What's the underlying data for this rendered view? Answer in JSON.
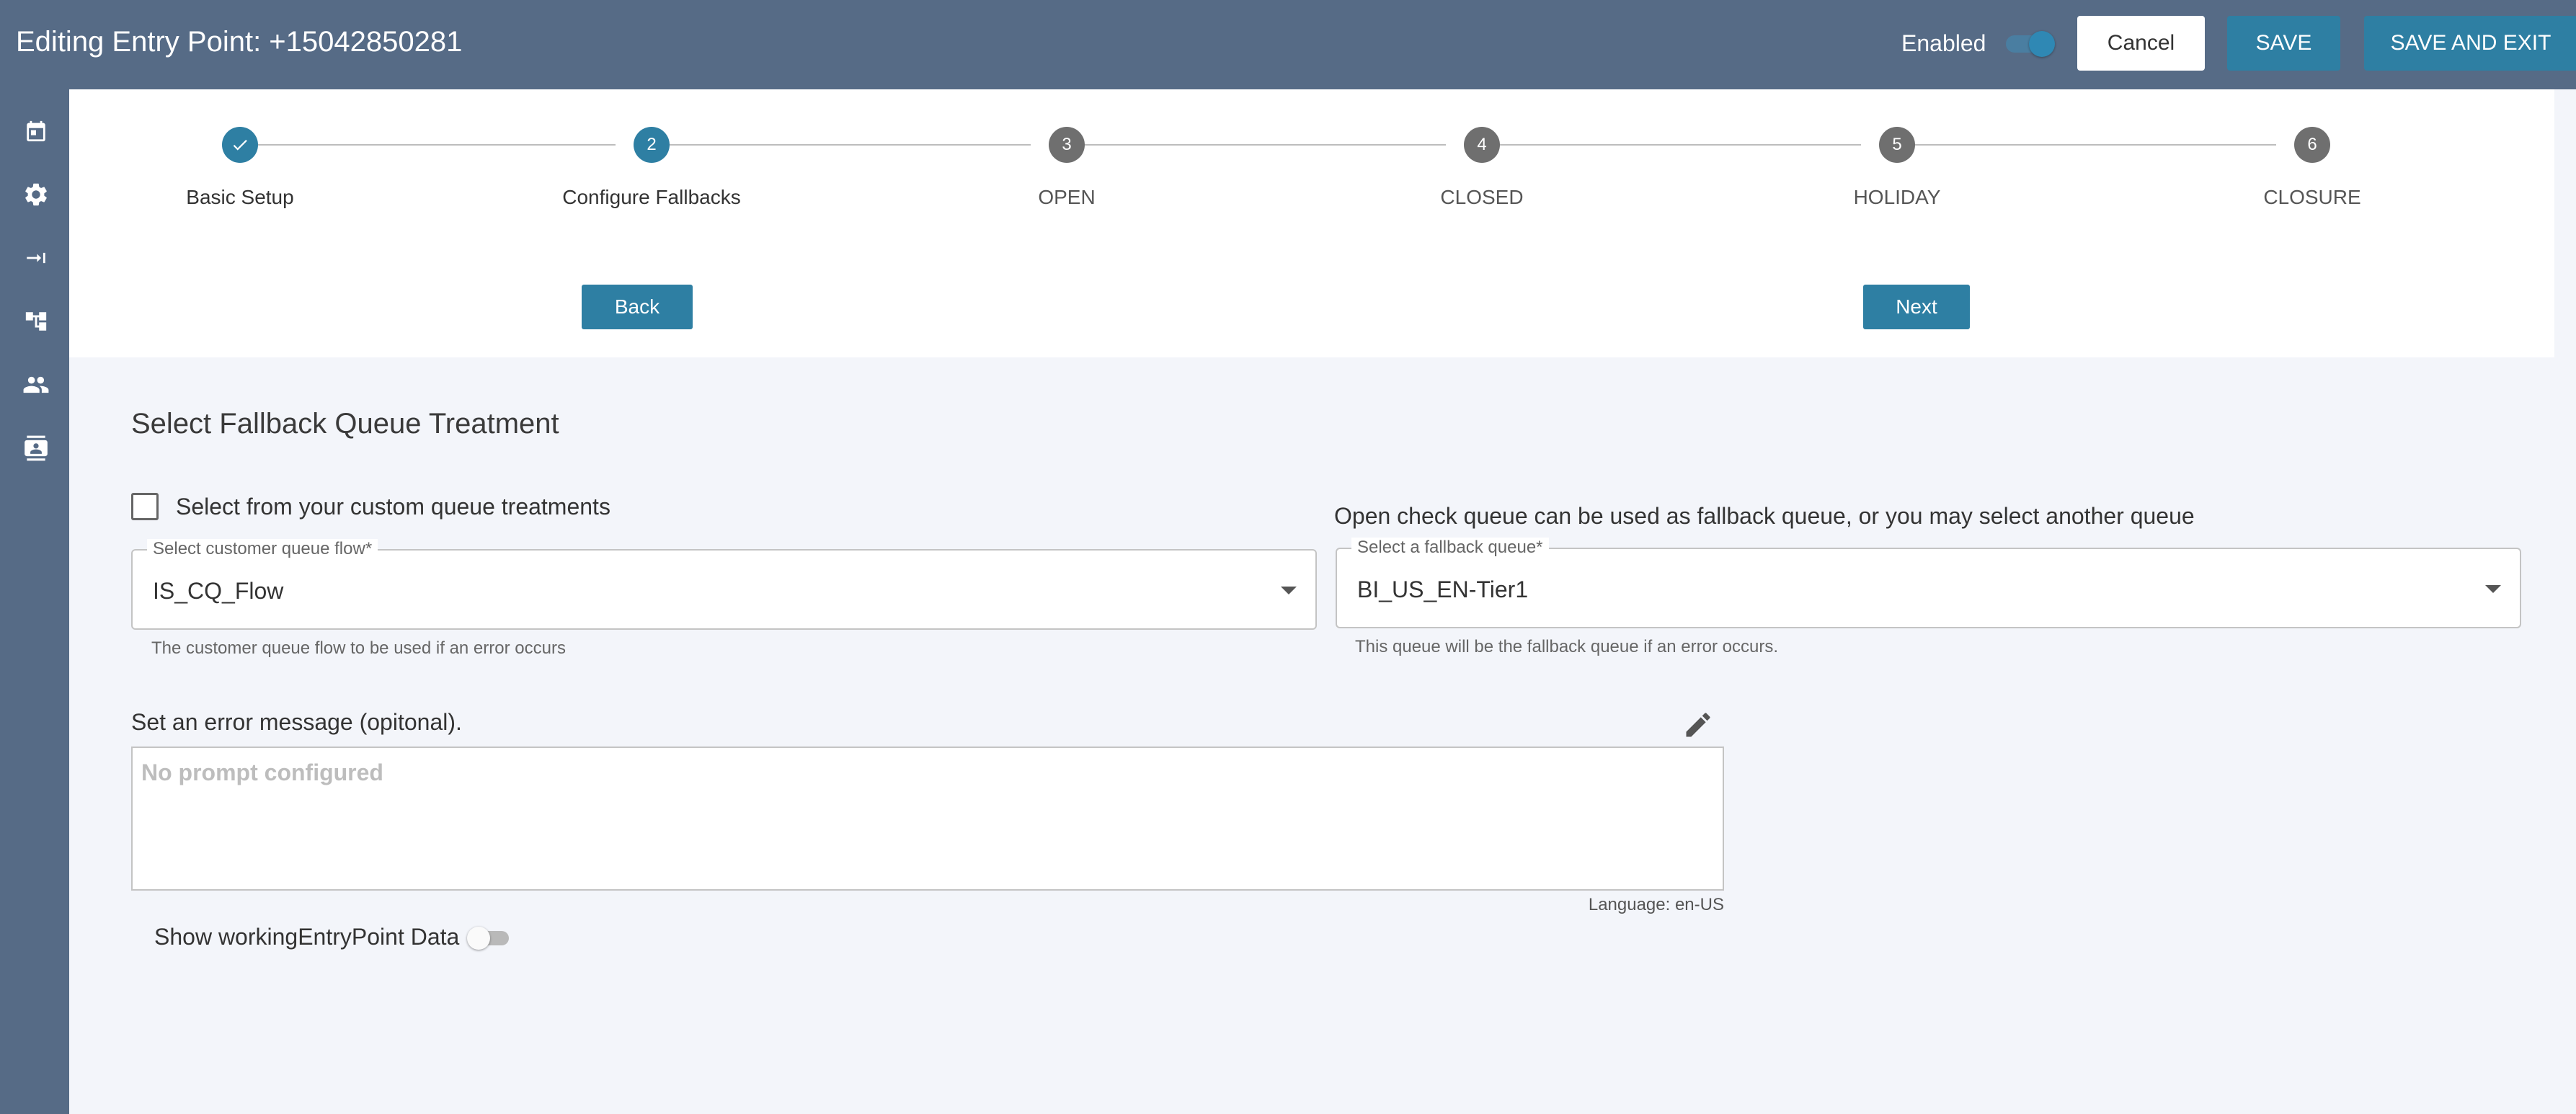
{
  "header": {
    "title": "Editing Entry Point: +15042850281",
    "enabled_label": "Enabled",
    "enabled": true,
    "cancel_label": "Cancel",
    "save_label": "SAVE",
    "save_exit_label": "SAVE AND EXIT"
  },
  "sidebar": {
    "items": [
      {
        "icon": "calendar-icon"
      },
      {
        "icon": "gear-icon"
      },
      {
        "icon": "merge-arrows-icon"
      },
      {
        "icon": "flow-tree-icon"
      },
      {
        "icon": "people-icon"
      },
      {
        "icon": "contact-card-icon"
      }
    ]
  },
  "stepper": {
    "steps": [
      {
        "number": "1",
        "label": "Basic Setup",
        "state": "done"
      },
      {
        "number": "2",
        "label": "Configure Fallbacks",
        "state": "active"
      },
      {
        "number": "3",
        "label": "OPEN",
        "state": "pending"
      },
      {
        "number": "4",
        "label": "CLOSED",
        "state": "pending"
      },
      {
        "number": "5",
        "label": "HOLIDAY",
        "state": "pending"
      },
      {
        "number": "6",
        "label": "CLOSURE",
        "state": "pending"
      }
    ],
    "back_label": "Back",
    "next_label": "Next"
  },
  "main": {
    "section_title": "Select Fallback Queue Treatment",
    "custom_checkbox_label": "Select from your custom queue treatments",
    "custom_checkbox_checked": false,
    "fallback_info": "Open check queue can be used as fallback queue, or you may select another queue",
    "customer_queue_flow": {
      "label": "Select customer queue flow*",
      "value": "IS_CQ_Flow",
      "helper": "The customer queue flow to be used if an error occurs"
    },
    "fallback_queue": {
      "label": "Select a fallback queue*",
      "value": "BI_US_EN-Tier1",
      "helper": "This queue will be the fallback queue if an error occurs."
    },
    "error_message_label": "Set an error message (opitonal).",
    "prompt_placeholder": "No prompt configured",
    "language": "Language: en-US",
    "show_data_label": "Show workingEntryPoint Data",
    "show_data_enabled": false
  },
  "colors": {
    "header_bg": "#566b86",
    "accent": "#2e7fa3",
    "page_bg": "#f3f5fa"
  }
}
